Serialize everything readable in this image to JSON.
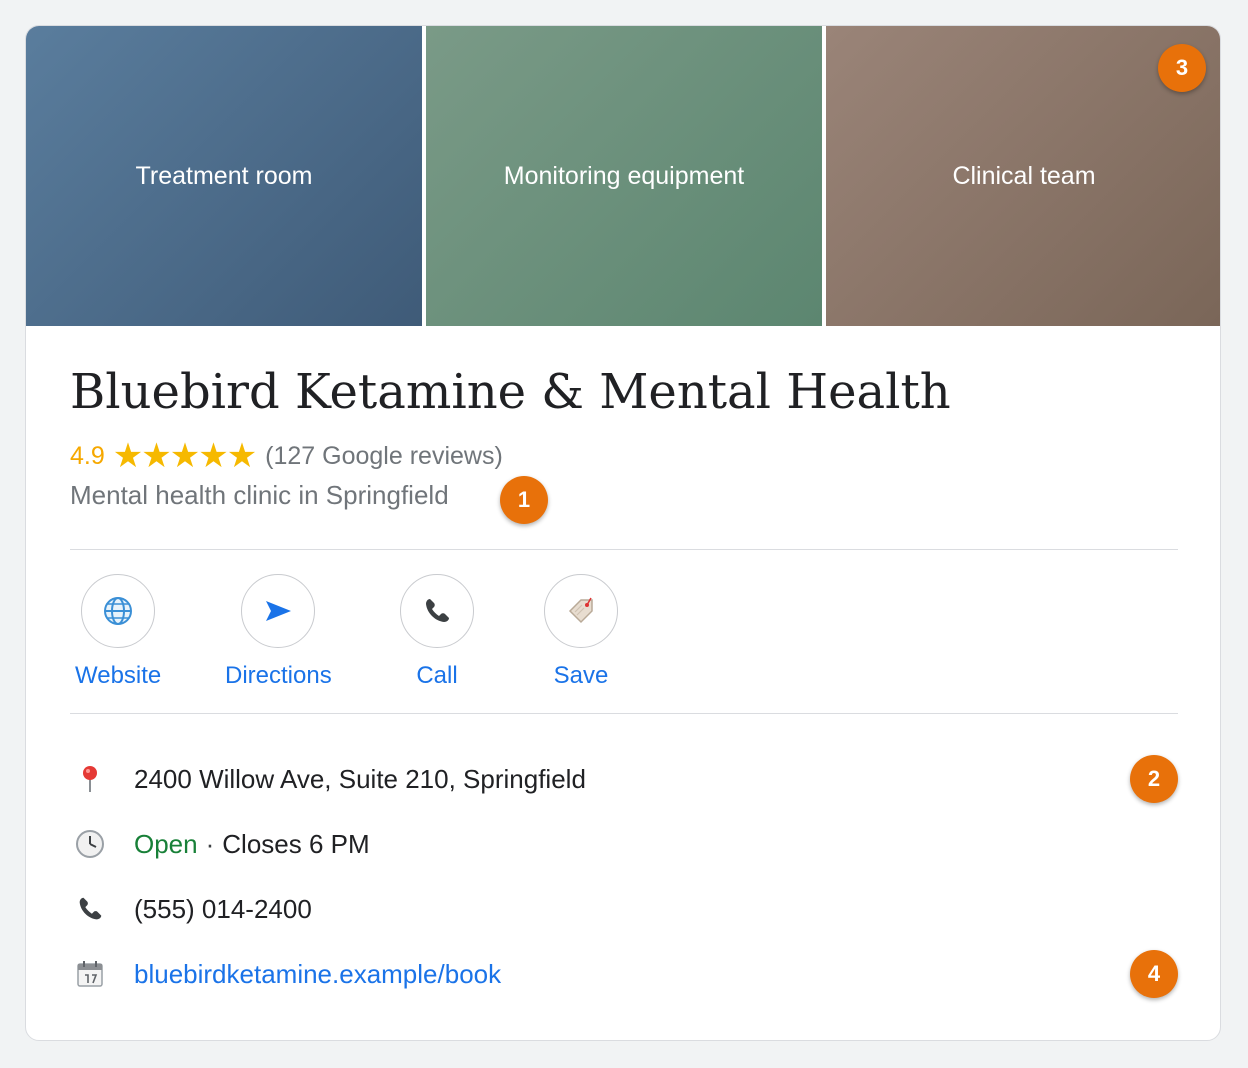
{
  "photos": [
    {
      "label": "Treatment room"
    },
    {
      "label": "Monitoring equipment"
    },
    {
      "label": "Clinical team"
    }
  ],
  "business": {
    "name": "Bluebird Ketamine & Mental Health",
    "rating": "4.9",
    "stars": "★★★★★",
    "reviews": "(127 Google reviews)",
    "category": "Mental health clinic in Springfield"
  },
  "actions": [
    {
      "label": "Website",
      "icon": "globe-icon"
    },
    {
      "label": "Directions",
      "icon": "directions-arrow-icon"
    },
    {
      "label": "Call",
      "icon": "phone-icon"
    },
    {
      "label": "Save",
      "icon": "bookmark-tag-icon"
    }
  ],
  "info": {
    "address": "2400 Willow Ave, Suite 210, Springfield",
    "hours_status": "Open",
    "hours_separator": "·",
    "hours_detail": "Closes 6 PM",
    "phone": "(555) 014-2400",
    "booking_link": "bluebirdketamine.example/book"
  },
  "badges": {
    "b1": "1",
    "b2": "2",
    "b3": "3",
    "b4": "4"
  },
  "colors": {
    "accent_link": "#1a73e8",
    "star": "#f6b900",
    "open": "#188038",
    "badge": "#e8710a"
  }
}
